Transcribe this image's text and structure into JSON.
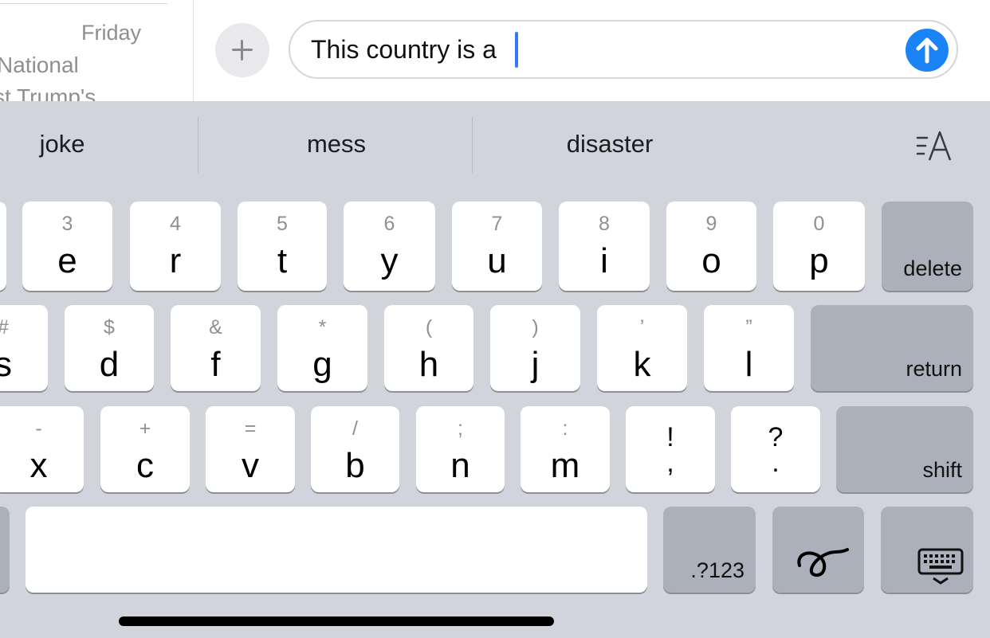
{
  "sidebar": {
    "date": "Friday",
    "line1": "National",
    "line2": "st Trump's"
  },
  "compose": {
    "text": "This country is a"
  },
  "suggestions": [
    "joke",
    "mess",
    "disaster"
  ],
  "keys": {
    "row1": [
      {
        "alt": "3",
        "char": "e"
      },
      {
        "alt": "4",
        "char": "r"
      },
      {
        "alt": "5",
        "char": "t"
      },
      {
        "alt": "6",
        "char": "y"
      },
      {
        "alt": "7",
        "char": "u"
      },
      {
        "alt": "8",
        "char": "i"
      },
      {
        "alt": "9",
        "char": "o"
      },
      {
        "alt": "0",
        "char": "p"
      }
    ],
    "delete": "delete",
    "row2": [
      {
        "alt": "#",
        "char": "s"
      },
      {
        "alt": "$",
        "char": "d"
      },
      {
        "alt": "&",
        "char": "f"
      },
      {
        "alt": "*",
        "char": "g"
      },
      {
        "alt": "(",
        "char": "h"
      },
      {
        "alt": ")",
        "char": "j"
      },
      {
        "alt": "’",
        "char": "k"
      },
      {
        "alt": "”",
        "char": "l"
      }
    ],
    "return": "return",
    "row3": [
      {
        "alt": "-",
        "char": "x"
      },
      {
        "alt": "+",
        "char": "c"
      },
      {
        "alt": "=",
        "char": "v"
      },
      {
        "alt": "/",
        "char": "b"
      },
      {
        "alt": ";",
        "char": "n"
      },
      {
        "alt": ":",
        "char": "m"
      }
    ],
    "punct": [
      {
        "top": "!",
        "bottom": ","
      },
      {
        "top": "?",
        "bottom": "."
      }
    ],
    "shift": "shift",
    "numbers": ".?123"
  },
  "icons": {
    "plus": "plus-icon",
    "send": "arrow-up-icon",
    "format": "text-format-icon",
    "scribble": "scribble-icon",
    "dismiss": "keyboard-dismiss-icon"
  },
  "colors": {
    "accent": "#1a84f7",
    "keyboard_bg": "#d1d4db",
    "key_gray": "#abb0ba"
  }
}
